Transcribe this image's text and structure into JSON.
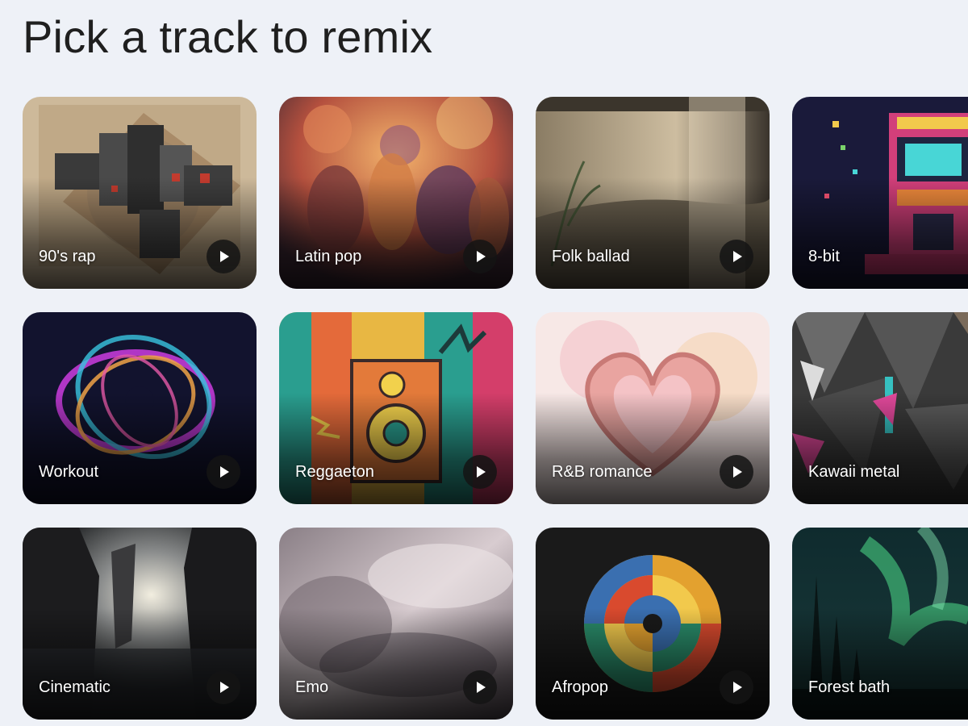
{
  "page": {
    "title": "Pick a track to remix",
    "background": "#eef1f7"
  },
  "tracks": [
    {
      "label": "90's rap",
      "art": "collage-cubes"
    },
    {
      "label": "Latin pop",
      "art": "dancing-crowd"
    },
    {
      "label": "Folk ballad",
      "art": "window-landscape"
    },
    {
      "label": "8-bit",
      "art": "pixel-arcade"
    },
    {
      "label": "Workout",
      "art": "neon-swirl"
    },
    {
      "label": "Reggaeton",
      "art": "speaker-poster"
    },
    {
      "label": "R&B romance",
      "art": "heart-hands"
    },
    {
      "label": "Kawaii metal",
      "art": "shard-collage"
    },
    {
      "label": "Cinematic",
      "art": "cliff-light"
    },
    {
      "label": "Emo",
      "art": "blurred-mist"
    },
    {
      "label": "Afropop",
      "art": "color-spiral"
    },
    {
      "label": "Forest bath",
      "art": "aurora-forest"
    }
  ],
  "play_icon": "play-icon"
}
